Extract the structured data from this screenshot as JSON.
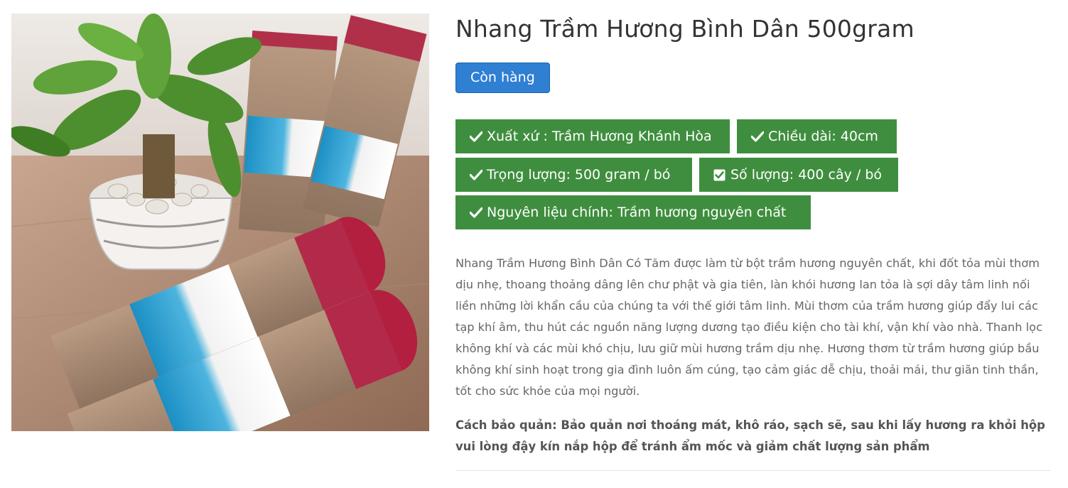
{
  "product": {
    "title": "Nhang Trầm Hương Bình Dân 500gram",
    "stock_label": "Còn hàng",
    "attributes": [
      {
        "icon": "check-icon",
        "label": "Xuất xứ : Trầm Hương Khánh Hòa"
      },
      {
        "icon": "check-icon",
        "label": "Chiều dài: 40cm"
      },
      {
        "icon": "check-icon",
        "label": "Trọng lượng: 500 gram / bó"
      },
      {
        "icon": "checkbox-checked-icon",
        "label": "Số lượng: 400 cây / bó"
      },
      {
        "icon": "check-icon",
        "label": "Nguyên liệu chính: Trầm hương nguyên chất"
      }
    ],
    "description": "Nhang Trầm Hương Bình Dân Có Tăm được làm từ bột trầm hương nguyên chất, khi đốt tỏa mùi thơm dịu nhẹ, thoang thoảng dâng lên chư phật và gia tiên, làn khói hương lan tỏa là sợi dây tâm linh nối liền những lời khẩn cầu của chúng ta với thế giới tâm linh. Mùi thơm của trầm hương giúp đẩy lui các tạp khí âm, thu hút các nguồn năng lượng dương tạo điều kiện cho tài khí, vận khí vào nhà. Thanh lọc không khí và các mùi khó chịu, lưu giữ mùi hương trầm dịu nhẹ. Hương thơm từ trầm hương giúp bầu không khí sinh hoạt trong gia đình luôn ấm cúng, tạo cảm giác dễ chịu, thoải mái, thư giãn tinh thần, tốt cho sức khỏe của mọi người.",
    "care": "Cách bảo quản: Bảo quản nơi thoáng mát, khô ráo, sạch sẽ, sau khi lấy hương ra khỏi hộp vui lòng đậy kín nắp hộp để tránh ẩm mốc và giảm chất lượng sản phẩm"
  },
  "colors": {
    "attribute_bg": "#3f8e3f",
    "stock_button_bg": "#2f7fd3",
    "title_text": "#333333"
  }
}
